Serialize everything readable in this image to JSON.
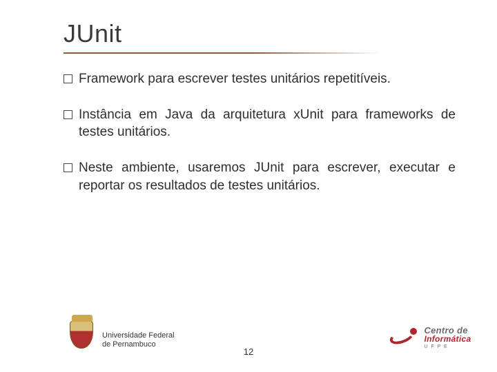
{
  "title": "JUnit",
  "bullets": [
    "Framework para escrever testes unitários repetitíveis.",
    "Instância em Java da arquitetura xUnit para frameworks de testes unitários.",
    "Neste ambiente, usaremos JUnit para escrever, executar e reportar os resultados de testes unitários."
  ],
  "footer": {
    "affiliation_line1": "Universidade Federal",
    "affiliation_line2": "de Pernambuco",
    "page_number": "12",
    "right_logo": {
      "line1": "Centro de",
      "line2": "Informática",
      "line3": "U  F  P  E"
    }
  },
  "icons": {
    "bullet": "hollow-square-icon",
    "left_logo": "ufpe-crest-icon",
    "right_logo": "cin-logo-icon"
  }
}
